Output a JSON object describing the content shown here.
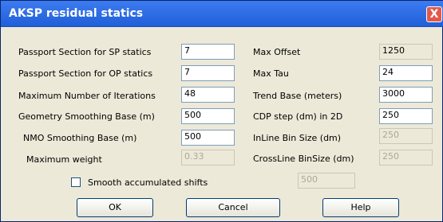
{
  "window": {
    "title": "AKSP residual statics",
    "close_glyph": "X"
  },
  "left": [
    {
      "label": "Passport Section for SP statics",
      "value": "7"
    },
    {
      "label": "Passport Section for OP statics",
      "value": "7"
    },
    {
      "label": "Maximum Number of Iterations",
      "value": "48"
    },
    {
      "label": "Geometry Smoothing Base (m)",
      "value": "500"
    },
    {
      "label": "NMO Smoothing Base (m)",
      "value": "500"
    },
    {
      "label": "Maximum weight",
      "value": "0.33"
    }
  ],
  "right": [
    {
      "label": "Max Offset",
      "value": "1250"
    },
    {
      "label": "Max Tau",
      "value": "24"
    },
    {
      "label": "Trend Base (meters)",
      "value": "3000"
    },
    {
      "label": "CDP step (dm) in 2D",
      "value": "250"
    },
    {
      "label": "InLine Bin Size (dm)",
      "value": "250"
    },
    {
      "label": "CrossLine BinSize (dm)",
      "value": "250"
    }
  ],
  "smooth": {
    "label": "Smooth accumulated shifts",
    "value": "500",
    "checked": false
  },
  "buttons": {
    "ok": "OK",
    "cancel": "Cancel",
    "help": "Help"
  }
}
